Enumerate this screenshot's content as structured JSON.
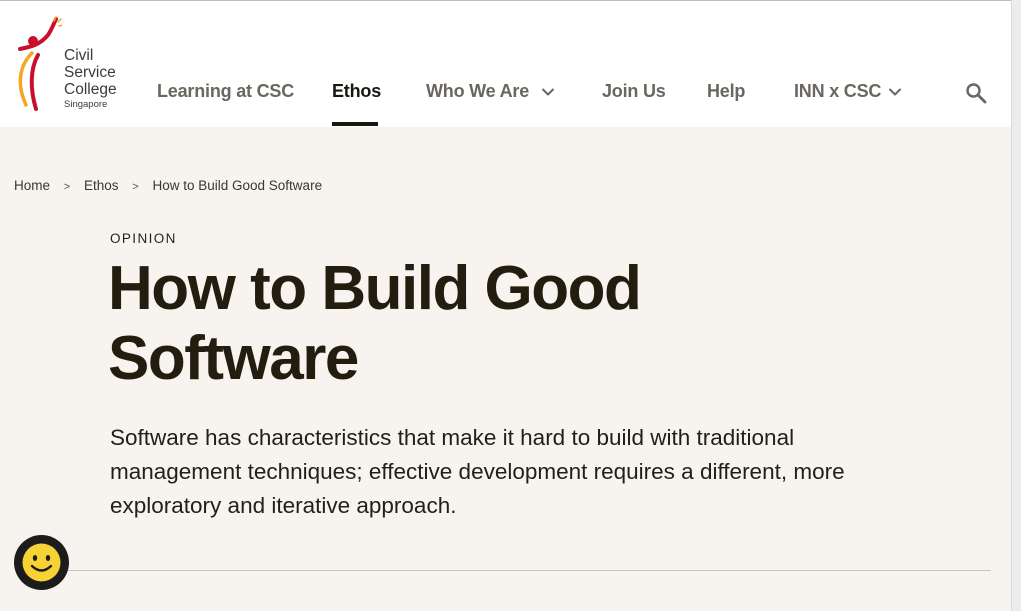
{
  "header": {
    "logo": {
      "lines": [
        "Civil",
        "Service",
        "College"
      ],
      "sub": "Singapore",
      "colors": {
        "red": "#c8102e",
        "orange": "#f5a623"
      }
    },
    "nav": [
      {
        "label": "Learning at CSC",
        "active": false,
        "has_dropdown": false
      },
      {
        "label": "Ethos",
        "active": true,
        "has_dropdown": false
      },
      {
        "label": "Who We Are",
        "active": false,
        "has_dropdown": true
      },
      {
        "label": "Join Us",
        "active": false,
        "has_dropdown": false
      },
      {
        "label": "Help",
        "active": false,
        "has_dropdown": false
      },
      {
        "label": "INN x CSC",
        "active": false,
        "has_dropdown": true
      }
    ],
    "search_icon": "search-icon"
  },
  "breadcrumb": {
    "items": [
      "Home",
      "Ethos",
      "How to Build Good Software"
    ],
    "separator": ">"
  },
  "article": {
    "kicker": "OPINION",
    "title": "How to Build Good Software",
    "lede": "Software has characteristics that make it hard to build with traditional management techniques; effective development requires a different, more exploratory and iterative approach."
  },
  "feedback_widget": {
    "icon": "smiley-icon",
    "color": "#f7d234"
  },
  "colors": {
    "page_bg": "#f7f4f0",
    "header_bg": "#ffffff",
    "text": "#231f16",
    "nav_text": "#6a6660"
  }
}
